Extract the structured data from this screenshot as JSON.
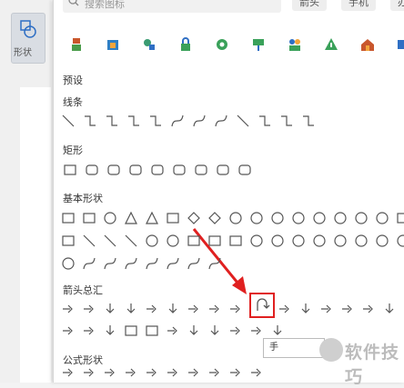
{
  "toolbar": {
    "shape_label": "形状"
  },
  "search": {
    "placeholder": "搜索图标",
    "tags": [
      "箭头",
      "手机",
      "办"
    ]
  },
  "sections": {
    "preset": "预设",
    "lines": "线条",
    "rect": "矩形",
    "basic": "基本形状",
    "arrows": "箭头总汇",
    "formula": "公式形状"
  },
  "tooltip": {
    "text": "手"
  },
  "watermark": {
    "text": "软件技巧"
  },
  "colors": {
    "highlight": "#e02020",
    "panel_bg": "#ffffff",
    "icon_stroke": "#555555"
  }
}
